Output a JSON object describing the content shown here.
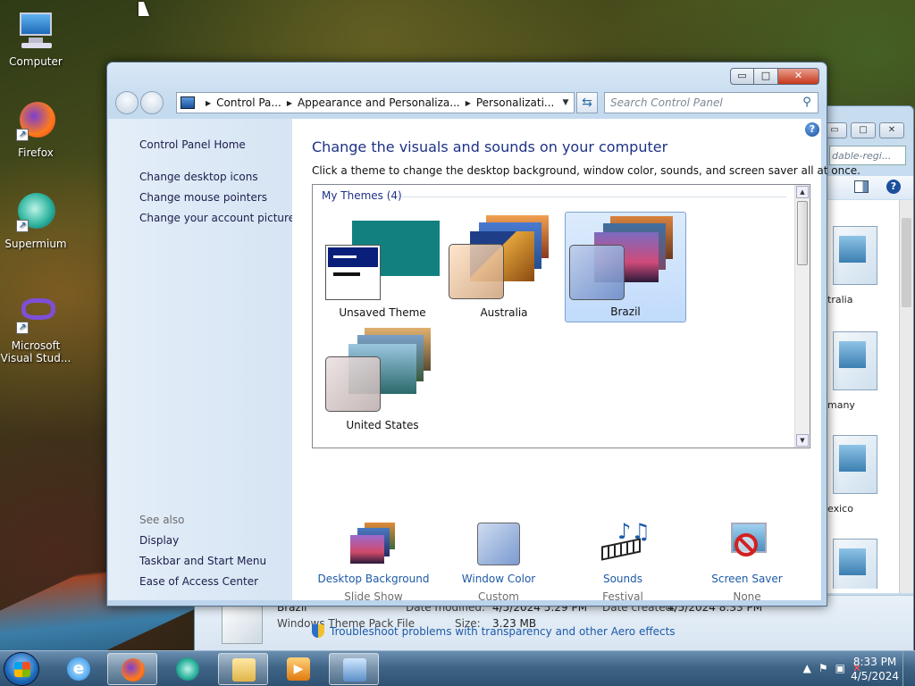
{
  "desktop": {
    "icons": [
      {
        "label": "Computer"
      },
      {
        "label": "Firefox"
      },
      {
        "label": "Supermium"
      },
      {
        "label": "Microsoft Visual Stud..."
      }
    ]
  },
  "back_window": {
    "search_text": "dable-regi...",
    "files": [
      {
        "label": "tralia"
      },
      {
        "label": "many"
      },
      {
        "label": "exico"
      },
      {
        "label": ""
      }
    ],
    "details": {
      "name": "Brazil",
      "type": "Windows Theme Pack File",
      "modified_label": "Date modified:",
      "modified_value": "4/5/2024 5:29 PM",
      "created_label": "Date created:",
      "created_value": "4/5/2024 8:33 PM",
      "size_label": "Size:",
      "size_value": "3.23 MB"
    }
  },
  "window": {
    "breadcrumb": [
      "Control Pa...",
      "Appearance and Personaliza...",
      "Personalizati..."
    ],
    "search_placeholder": "Search Control Panel",
    "left_pane": {
      "home": "Control Panel Home",
      "links": [
        "Change desktop icons",
        "Change mouse pointers",
        "Change your account picture"
      ],
      "see_also_title": "See also",
      "see_also": [
        "Display",
        "Taskbar and Start Menu",
        "Ease of Access Center"
      ]
    },
    "heading": "Change the visuals and sounds on your computer",
    "subheading": "Click a theme to change the desktop background, window color, sounds, and screen saver all at once.",
    "group_title": "My Themes (4)",
    "themes": [
      {
        "label": "Unsaved Theme",
        "selected": false
      },
      {
        "label": "Australia",
        "selected": false
      },
      {
        "label": "Brazil",
        "selected": true
      },
      {
        "label": "United States",
        "selected": false
      }
    ],
    "bottom": [
      {
        "title": "Desktop Background",
        "value": "Slide Show",
        "icon": "desktop-background-icon"
      },
      {
        "title": "Window Color",
        "value": "Custom",
        "icon": "window-color-icon"
      },
      {
        "title": "Sounds",
        "value": "Festival",
        "icon": "sounds-icon"
      },
      {
        "title": "Screen Saver",
        "value": "None",
        "icon": "screen-saver-icon"
      }
    ],
    "troubleshoot": "Troubleshoot problems with transparency and other Aero effects",
    "caption_buttons": {
      "minimize": "▭",
      "maximize": "□",
      "close": "✕"
    }
  },
  "taskbar": {
    "time": "8:33 PM",
    "date": "4/5/2024"
  }
}
